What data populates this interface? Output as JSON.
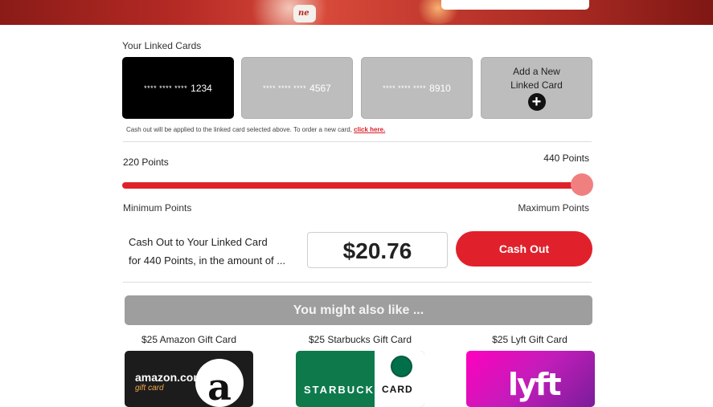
{
  "hero": {
    "badge_text": "ne"
  },
  "linked_cards": {
    "title": "Your Linked Cards",
    "cards": [
      {
        "mask": "**** **** ****",
        "last4": "1234",
        "selected": true
      },
      {
        "mask": "**** **** ****",
        "last4": "4567",
        "selected": false
      },
      {
        "mask": "**** **** ****",
        "last4": "8910",
        "selected": false
      }
    ],
    "add_card_label_line1": "Add a New",
    "add_card_label_line2": "Linked Card",
    "note": "Cash out will be applied to the linked card selected above. To order a new card,",
    "note_link": "click here."
  },
  "points": {
    "current": "220 Points",
    "max_value": "440 Points",
    "min_label": "Minimum Points",
    "max_label": "Maximum Points",
    "slider_level": 1.0
  },
  "cashout": {
    "line1": "Cash Out to Your Linked Card",
    "line2": "for 440 Points, in the amount of ...",
    "amount": "$20.76",
    "button_label": "Cash Out"
  },
  "suggestions": {
    "title": "You might also like ...",
    "items": [
      {
        "title": "$25 Amazon Gift Card",
        "brand": "amazon.com",
        "brand_sub": "gift card",
        "mark": "a"
      },
      {
        "title": "$25 Starbucks Gift Card",
        "brand": "STARBUCKS",
        "brand_sub": "CARD"
      },
      {
        "title": "$25 Lyft Gift Card",
        "brand": "lyft"
      }
    ]
  },
  "colors": {
    "accent": "#e0212b",
    "thumb": "#f08080",
    "card_selected": "#000000",
    "card_default": "#bdbdbd"
  }
}
